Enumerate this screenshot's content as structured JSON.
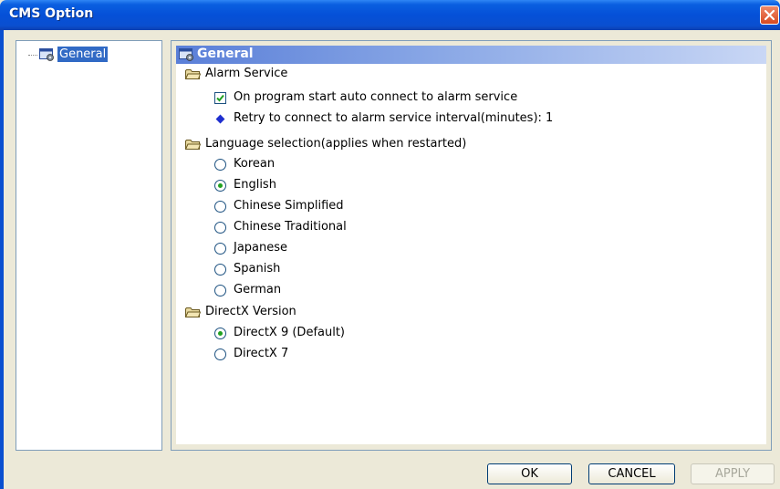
{
  "window": {
    "title": "CMS Option"
  },
  "tree": {
    "items": [
      {
        "label": "General"
      }
    ]
  },
  "panel": {
    "header": "General",
    "alarm": {
      "group_label": "Alarm Service",
      "auto_connect_label": "On program start auto connect to alarm service",
      "auto_connect_checked": true,
      "retry_label": "Retry to connect to alarm service interval(minutes): 1"
    },
    "language": {
      "group_label": "Language selection(applies when restarted)",
      "options": [
        "Korean",
        "English",
        "Chinese Simplified",
        "Chinese Traditional",
        "Japanese",
        "Spanish",
        "German"
      ],
      "selected": "English"
    },
    "directx": {
      "group_label": "DirectX Version",
      "options": [
        "DirectX 9 (Default)",
        "DirectX 7"
      ],
      "selected": "DirectX 9 (Default)"
    }
  },
  "buttons": {
    "ok": "OK",
    "cancel": "CANCEL",
    "apply": "APPLY"
  },
  "colors": {
    "titlebar": "#0550d8",
    "selection": "#316ac5",
    "radio_dot": "#21a121",
    "bullet": "#1f2fcf"
  }
}
